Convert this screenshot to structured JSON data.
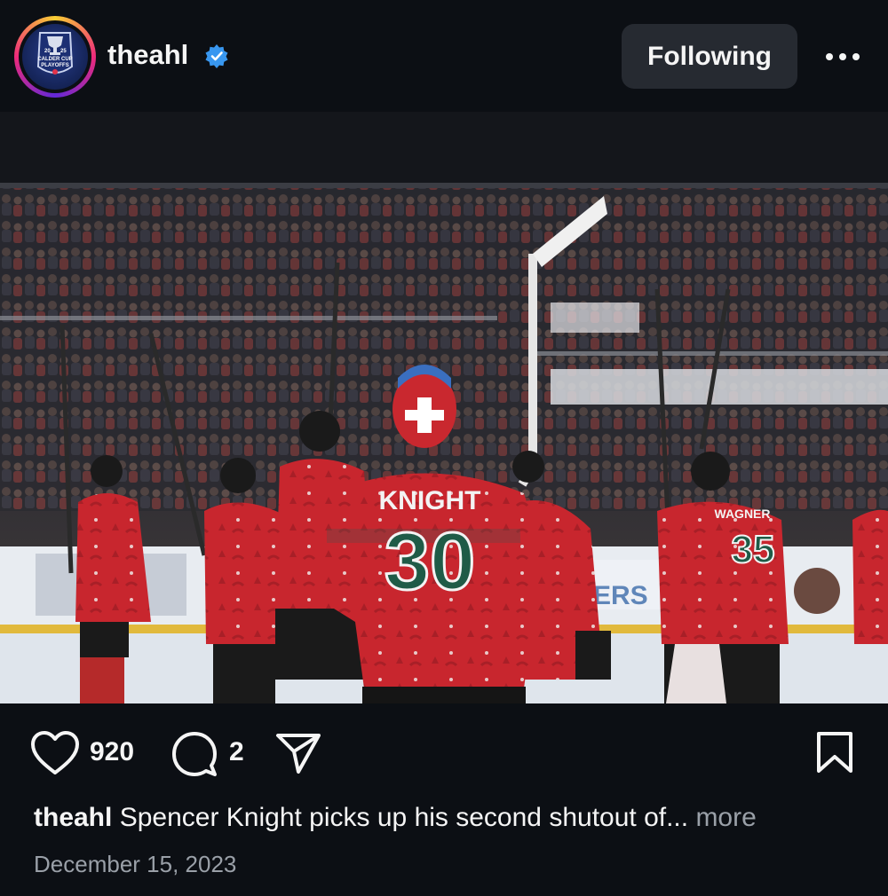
{
  "header": {
    "username": "theahl",
    "follow_label": "Following",
    "avatar_logo_text": [
      "20",
      "25",
      "CALDER CUP",
      "PLAYOFFS"
    ]
  },
  "photo": {
    "player_name": "KNIGHT",
    "player_number": "30",
    "teammate_number": "35",
    "teammate_name": "WAGNER",
    "arena_banner_fragment": "ERS"
  },
  "actions": {
    "like_count": "920",
    "comment_count": "2"
  },
  "caption": {
    "username": "theahl",
    "text": "Spencer Knight picks up his second shutout of...",
    "more_label": "more"
  },
  "date": "December 15, 2023",
  "colors": {
    "background": "#0c0f14",
    "button_bg": "#262a31",
    "verified_blue": "#3897f0",
    "secondary_text": "#9aa0a8",
    "jersey_red": "#c8262e",
    "jersey_green": "#1f5b47"
  },
  "icons": [
    "verified-badge-icon",
    "more-options-icon",
    "heart-icon",
    "comment-icon",
    "share-icon",
    "bookmark-icon"
  ]
}
